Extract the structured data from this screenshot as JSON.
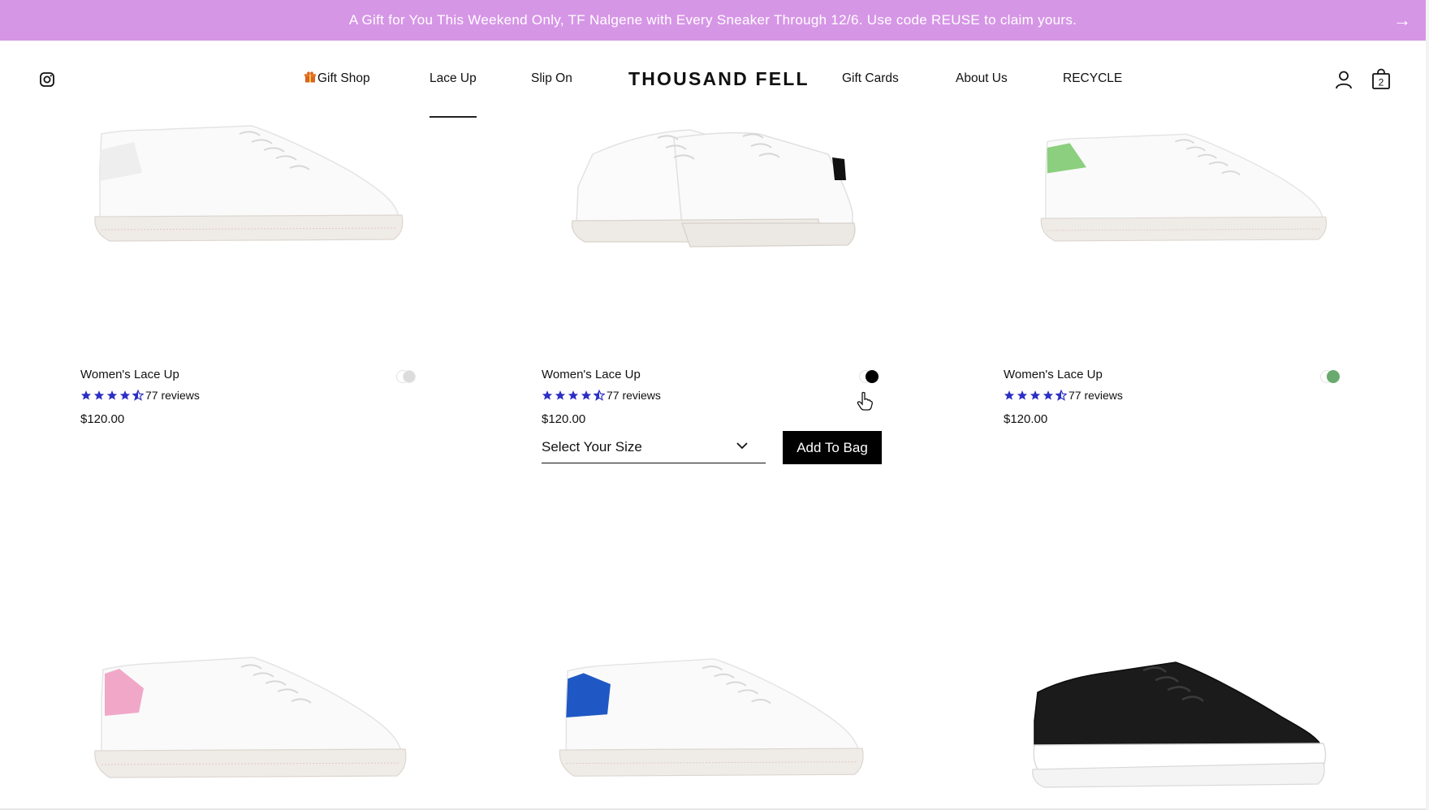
{
  "promo": {
    "text": "A Gift for You This Weekend Only, TF Nalgene with Every Sneaker Through 12/6. Use code REUSE to claim yours.",
    "arrow": "→"
  },
  "header": {
    "logo": "THOUSAND FELL",
    "nav_left": [
      "Gift Shop",
      "Lace Up",
      "Slip On"
    ],
    "nav_right": [
      "Gift Cards",
      "About Us",
      "RECYCLE"
    ],
    "active_nav": "Lace Up",
    "bag_count": "2",
    "icons": [
      "instagram-icon",
      "gift-icon",
      "account-icon",
      "shopping-bag-icon"
    ]
  },
  "products": [
    {
      "name": "Women's Lace Up",
      "reviews": "77 reviews",
      "price": "$120.00",
      "rating": 4.5,
      "heel_color": "#ececec",
      "swatch_color": "#dcdcdc"
    },
    {
      "name": "Women's Lace Up",
      "reviews": "77 reviews",
      "price": "$120.00",
      "rating": 4.5,
      "heel_color": "#111111",
      "swatch_color": "#000000"
    },
    {
      "name": "Women's Lace Up",
      "reviews": "77 reviews",
      "price": "$120.00",
      "rating": 4.5,
      "heel_color": "#8ccf7e",
      "swatch_color": "#6aaa6e"
    }
  ],
  "bottom_products": [
    {
      "heel_color": "#f1a8c8"
    },
    {
      "heel_color": "#1f58c4"
    },
    {
      "body_color": "#1b1b1b"
    }
  ],
  "quick_add": {
    "size_placeholder": "Select Your Size",
    "add_label": "Add To Bag"
  },
  "colors": {
    "promo_bg": "#d696e6",
    "star": "#2c2fc4",
    "button_bg": "#000000"
  }
}
